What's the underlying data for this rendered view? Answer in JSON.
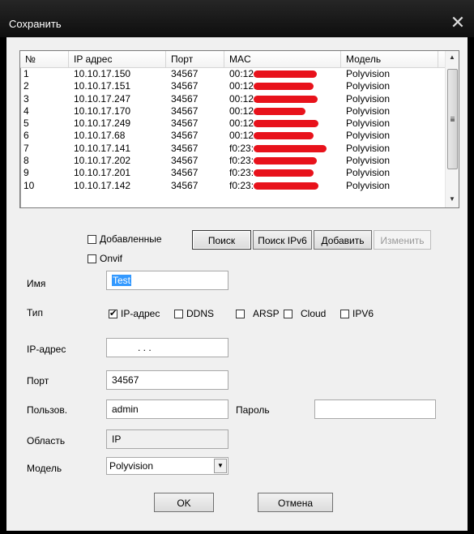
{
  "window": {
    "title": "Сохранить",
    "close_icon": "close-icon"
  },
  "device_list": {
    "columns": [
      "№",
      "IP адрес",
      "Порт",
      "MAC",
      "Модель"
    ],
    "rows": [
      {
        "n": "1",
        "ip": "10.10.17.150",
        "port": "34567",
        "mac": "00:12:",
        "model": "Polyvision"
      },
      {
        "n": "2",
        "ip": "10.10.17.151",
        "port": "34567",
        "mac": "00:12:",
        "model": "Polyvision"
      },
      {
        "n": "3",
        "ip": "10.10.17.247",
        "port": "34567",
        "mac": "00:12:",
        "model": "Polyvision"
      },
      {
        "n": "4",
        "ip": "10.10.17.170",
        "port": "34567",
        "mac": "00:12:",
        "model": "Polyvision"
      },
      {
        "n": "5",
        "ip": "10.10.17.249",
        "port": "34567",
        "mac": "00:12:",
        "model": "Polyvision"
      },
      {
        "n": "6",
        "ip": "10.10.17.68",
        "port": "34567",
        "mac": "00:12:",
        "model": "Polyvision"
      },
      {
        "n": "7",
        "ip": "10.10.17.141",
        "port": "34567",
        "mac": "f0:23:",
        "model": "Polyvision"
      },
      {
        "n": "8",
        "ip": "10.10.17.202",
        "port": "34567",
        "mac": "f0:23:",
        "model": "Polyvision"
      },
      {
        "n": "9",
        "ip": "10.10.17.201",
        "port": "34567",
        "mac": "f0:23:",
        "model": "Polyvision"
      },
      {
        "n": "10",
        "ip": "10.10.17.142",
        "port": "34567",
        "mac": "f0:23:",
        "model": "Polyvision"
      }
    ],
    "redaction_color": "#e8121b"
  },
  "filters": {
    "added_label": "Добавленные",
    "onvif_label": "Onvif"
  },
  "buttons": {
    "search": "Поиск",
    "search_ipv6": "Поиск IPv6",
    "add": "Добавить",
    "edit": "Изменить",
    "ok": "OK",
    "cancel": "Отмена"
  },
  "form": {
    "name_label": "Имя",
    "name_value": "Test",
    "type_label": "Тип",
    "types": [
      {
        "label": "IP-адрес",
        "checked": true
      },
      {
        "label": "DDNS",
        "checked": false
      },
      {
        "label": "ARSP",
        "checked": false
      },
      {
        "label": "Cloud",
        "checked": false
      },
      {
        "label": "IPV6",
        "checked": false
      }
    ],
    "ip_label": "IP-адрес",
    "ip_value": ".       .       .",
    "port_label": "Порт",
    "port_value": "34567",
    "user_label": "Пользов.",
    "user_value": "admin",
    "password_label": "Пароль",
    "password_value": "",
    "area_label": "Область",
    "area_value": "IP",
    "model_label": "Модель",
    "model_value": "Polyvision"
  }
}
